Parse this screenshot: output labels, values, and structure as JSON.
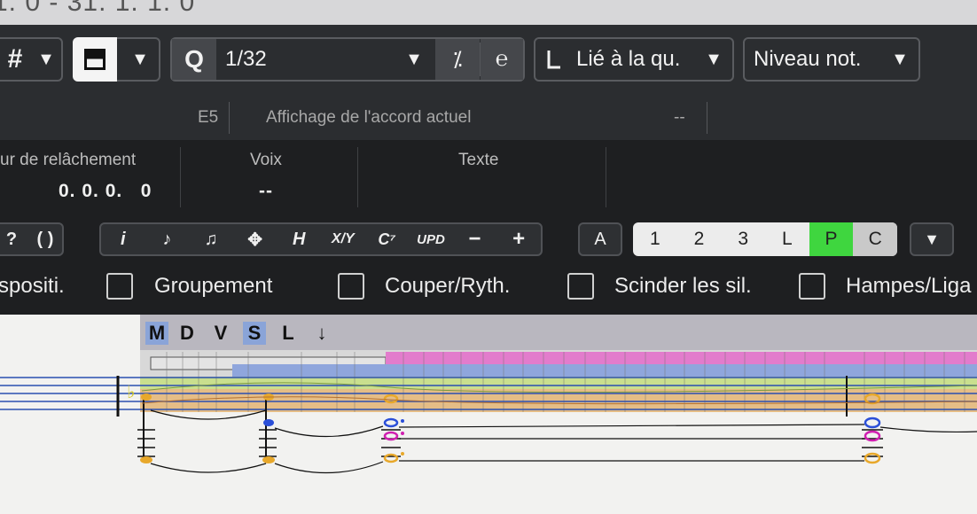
{
  "title_fragment": "1. 0 - 31. 1. 1. 0",
  "toolbar": {
    "sharp_icon": "sharp-icon",
    "dropdown_icon": "chevron-down-icon",
    "q_label": "Q",
    "quantize_value": "1/32",
    "length_label": "Lié à la qu.",
    "level_label": "Niveau not."
  },
  "info": {
    "note": "E5",
    "chord_label": "Affichage de l'accord actuel",
    "chord_value": "--"
  },
  "fields": {
    "release_label": "ur de relâchement",
    "release_value": "0. 0. 0.   0",
    "voice_label": "Voix",
    "voice_value": "--",
    "text_label": "Texte"
  },
  "tools": {
    "left_items": [
      "?",
      "( )"
    ],
    "items": [
      "i",
      "♪",
      "♫",
      "✥",
      "H",
      "X/Y",
      "C⁷",
      "UPD",
      "−",
      "+"
    ],
    "a_label": "A",
    "voices": [
      "1",
      "2",
      "3",
      "L",
      "P",
      "C"
    ],
    "active_voice": "P",
    "active_color": "#3fd63f"
  },
  "checks": {
    "items": [
      "spositi.",
      "Groupement",
      "Couper/Ryth.",
      "Scinder les sil.",
      "Hampes/Liga"
    ]
  },
  "score": {
    "filters": [
      "M",
      "D",
      "V",
      "S",
      "L",
      "↓"
    ],
    "highlighted": [
      "M",
      "S"
    ]
  }
}
